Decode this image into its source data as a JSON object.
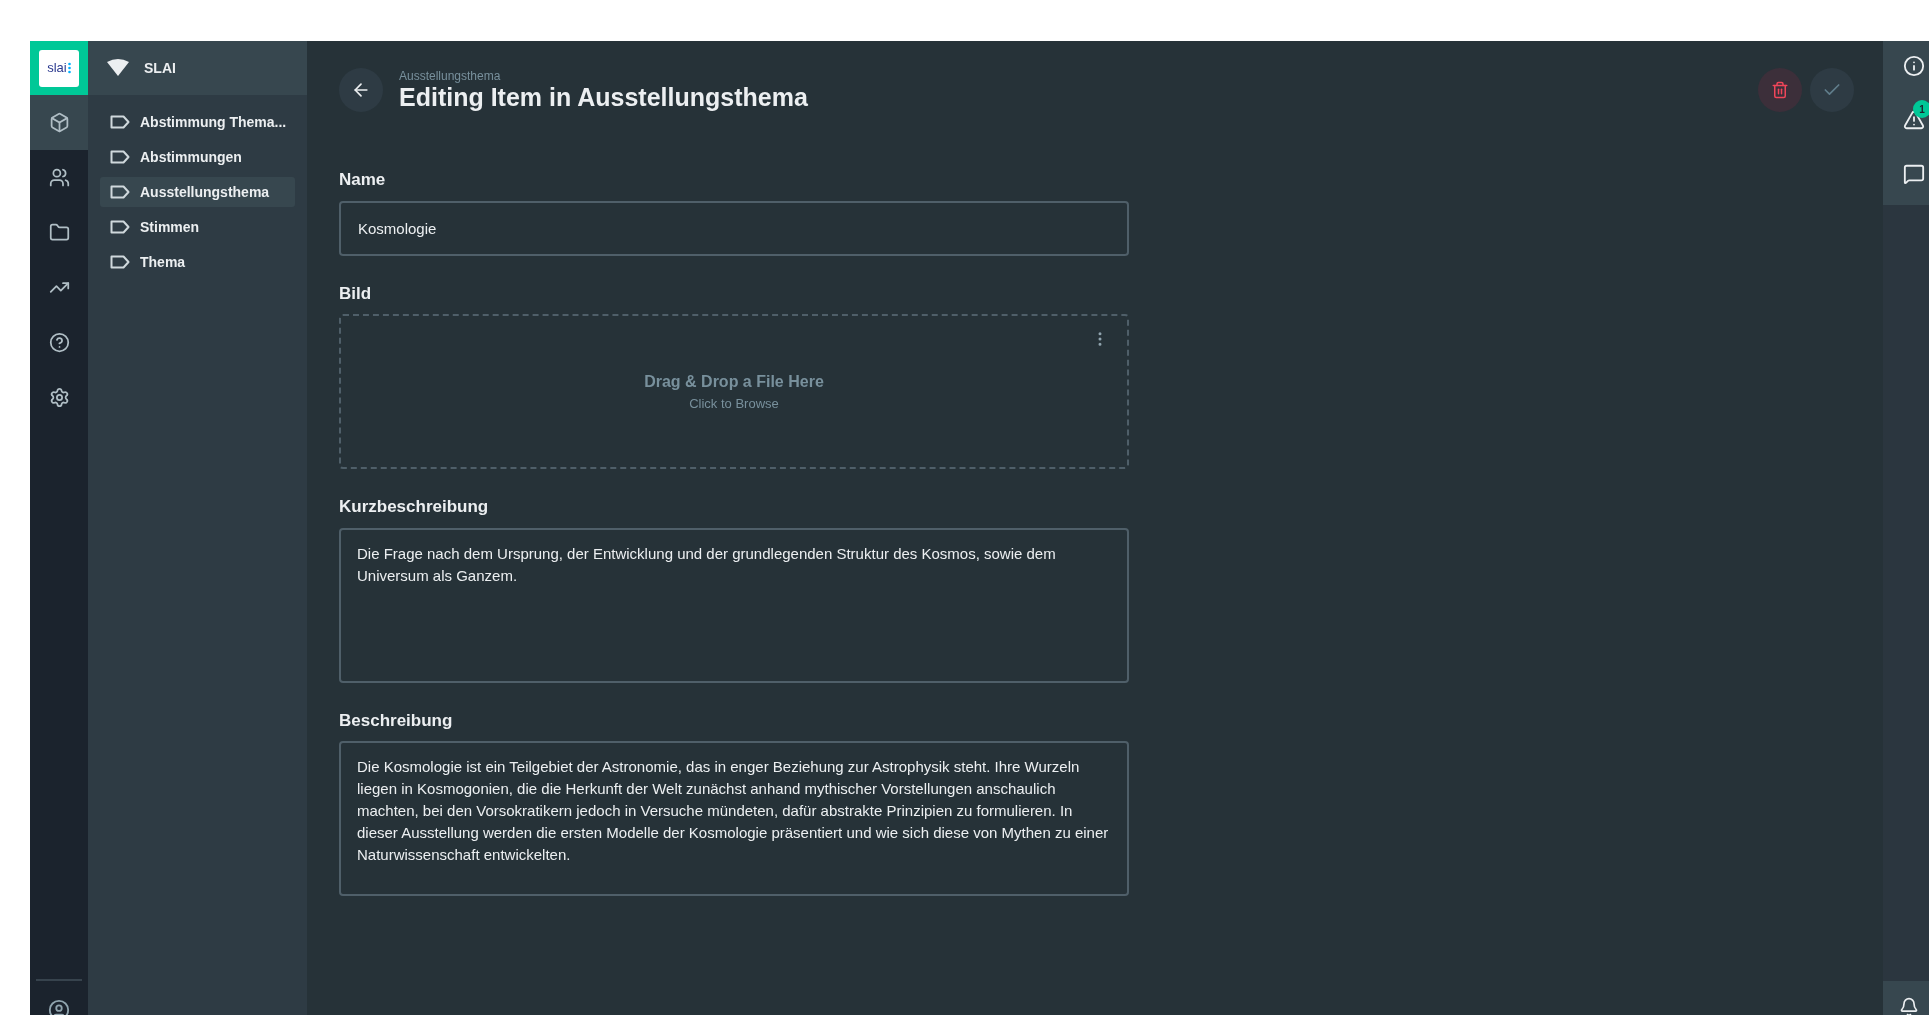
{
  "logo": {
    "text": "slai"
  },
  "rail": {
    "items": [
      {
        "kind": "cube",
        "selected": true
      },
      {
        "kind": "users",
        "selected": false
      },
      {
        "kind": "folder",
        "selected": false
      },
      {
        "kind": "insights",
        "selected": false
      },
      {
        "kind": "help",
        "selected": false
      },
      {
        "kind": "settings",
        "selected": false
      }
    ]
  },
  "project": {
    "name": "SLAI"
  },
  "collections": [
    {
      "label": "Abstimmung Thema...",
      "selected": false
    },
    {
      "label": "Abstimmungen",
      "selected": false
    },
    {
      "label": "Ausstellungsthema",
      "selected": true
    },
    {
      "label": "Stimmen",
      "selected": false
    },
    {
      "label": "Thema",
      "selected": false
    }
  ],
  "header": {
    "breadcrumb": "Ausstellungsthema",
    "title": "Editing Item in Ausstellungsthema"
  },
  "fields": [
    {
      "kind": "input",
      "label": "Name",
      "value": "Kosmologie"
    },
    {
      "kind": "file",
      "label": "Bild",
      "prompt": "Drag & Drop a File Here",
      "hint": "Click to Browse"
    },
    {
      "kind": "textarea",
      "label": "Kurzbeschreibung",
      "value": "Die Frage nach dem Ursprung, der Entwicklung und der grundlegenden Struktur des Kosmos, sowie dem Universum als Ganzem."
    },
    {
      "kind": "textarea",
      "label": "Beschreibung",
      "value": "Die Kosmologie ist ein Teilgebiet der Astronomie, das in enger Beziehung zur Astrophysik steht. Ihre Wurzeln liegen in Kosmogonien, die die Herkunft der Welt zunächst anhand mythischer Vorstellungen anschaulich machten, bei den Vorsokratikern jedoch in Versuche mündeten, dafür abstrakte Prinzipien zu formulieren. In dieser Ausstellung werden die ersten Modelle der Kosmologie präsentiert und wie sich diese von Mythen zu einer Naturwissenschaft entwickelten."
    }
  ],
  "sidebar_right": {
    "notifications_badge": "1"
  }
}
